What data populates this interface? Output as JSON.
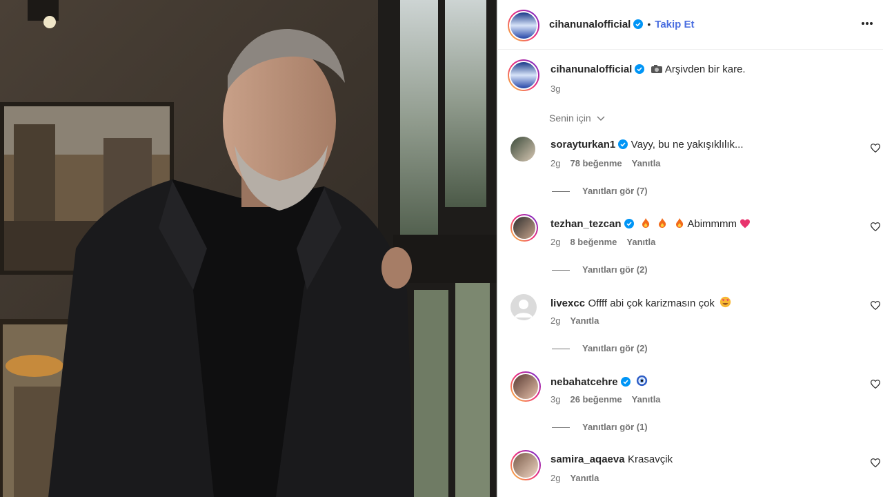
{
  "post": {
    "author": "cihanunalofficial",
    "follow_label": "Takip Et",
    "separator": "•",
    "caption_icon": "camera-emoji",
    "caption": "Arşivden bir kare.",
    "caption_time": "3g",
    "sort_label": "Senin için",
    "colors": {
      "verified": "#0095f6",
      "follow": "#4a6ee0",
      "like": "#262626"
    }
  },
  "comments": [
    {
      "user": "sorayturkan1",
      "text": "Vayy, bu ne yakışıklılık...",
      "time": "2g",
      "likes": "78 beğenme",
      "reply": "Yanıtla",
      "view_replies": "Yanıtları gör (7)",
      "verified": true
    },
    {
      "user": "tezhan_tezcan",
      "text": "Abimmmm",
      "time": "2g",
      "likes": "8 beğenme",
      "reply": "Yanıtla",
      "view_replies": "Yanıtları gör (2)",
      "verified": true,
      "emoji_prefix": [
        "fire-emoji",
        "fire-emoji",
        "fire-emoji"
      ],
      "emoji_suffix": "heart-emoji"
    },
    {
      "user": "livexcc",
      "text": "Offff abi çok karizmasın çok",
      "time": "2g",
      "likes": "",
      "reply": "Yanıtla",
      "view_replies": "Yanıtları gör (2)",
      "verified": false,
      "emoji_suffix": "heart-eyes-emoji"
    },
    {
      "user": "nebahatcehre",
      "text": "",
      "time": "3g",
      "likes": "26 beğenme",
      "reply": "Yanıtla",
      "view_replies": "Yanıtları gör (1)",
      "verified": true,
      "emoji_suffix": "nazar-emoji"
    },
    {
      "user": "samira_aqaeva",
      "text": "Krasavçik",
      "time": "2g",
      "likes": "",
      "reply": "Yanıtla",
      "view_replies": "",
      "verified": false
    }
  ]
}
